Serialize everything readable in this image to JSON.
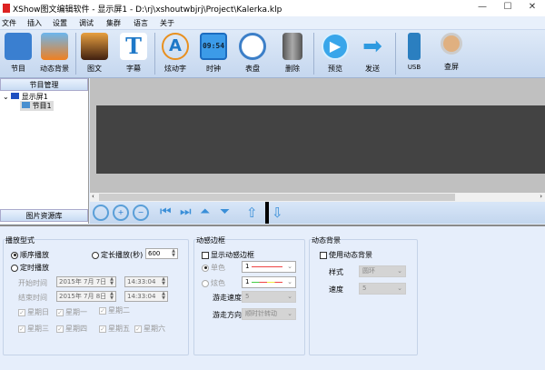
{
  "window": {
    "title": "XShow图文编辑软件 - 显示屏1 - D:\\rj\\xshoutwbjrj\\Project\\Kalerka.klp",
    "minimize": "—",
    "maximize": "☐",
    "close": "✕"
  },
  "menu": [
    "文件",
    "插入",
    "设置",
    "调试",
    "集群",
    "语言",
    "关于"
  ],
  "toolbar": [
    "节目",
    "动态背景",
    "图文",
    "字幕",
    "炫动字",
    "时钟",
    "表盘",
    "删除",
    "预览",
    "发送",
    "USB",
    "查屏"
  ],
  "clock_icon_text": "09:54",
  "left_panel": {
    "header": "节目管理",
    "tree": {
      "root": "显示屏1",
      "child": "节目1"
    },
    "footer": "图片资源库"
  },
  "play_mode": {
    "title": "播放型式",
    "sequential": "顺序播放",
    "fixed_length": "定长播放(秒)",
    "fixed_length_value": "600",
    "timed": "定时播放",
    "start_label": "开始时间",
    "start_date": "2015年  7月  7日",
    "start_time": "14:33:04",
    "end_label": "结束时间",
    "end_date": "2015年  7月  8日",
    "end_time": "14:33:04",
    "days": [
      "星期日",
      "星期一",
      "星期二",
      "星期三",
      "星期四",
      "星期五",
      "星期六"
    ]
  },
  "border": {
    "title": "动感边框",
    "show": "显示动感边框",
    "single": "单色",
    "single_value": "1",
    "color": "炫色",
    "color_value": "1",
    "speed_label": "游走速度",
    "speed_value": "5",
    "direction_label": "游走方向",
    "direction_value": "顺时针转动"
  },
  "background": {
    "title": "动态背景",
    "use": "使用动态背景",
    "style_label": "样式",
    "style_value": "圆环",
    "speed_label": "速度",
    "speed_value": "5"
  },
  "colors": {
    "accent": "#3a8fd8",
    "canvas": "#c0c0c0",
    "screen": "#434343",
    "panel": "#e6eefb"
  }
}
